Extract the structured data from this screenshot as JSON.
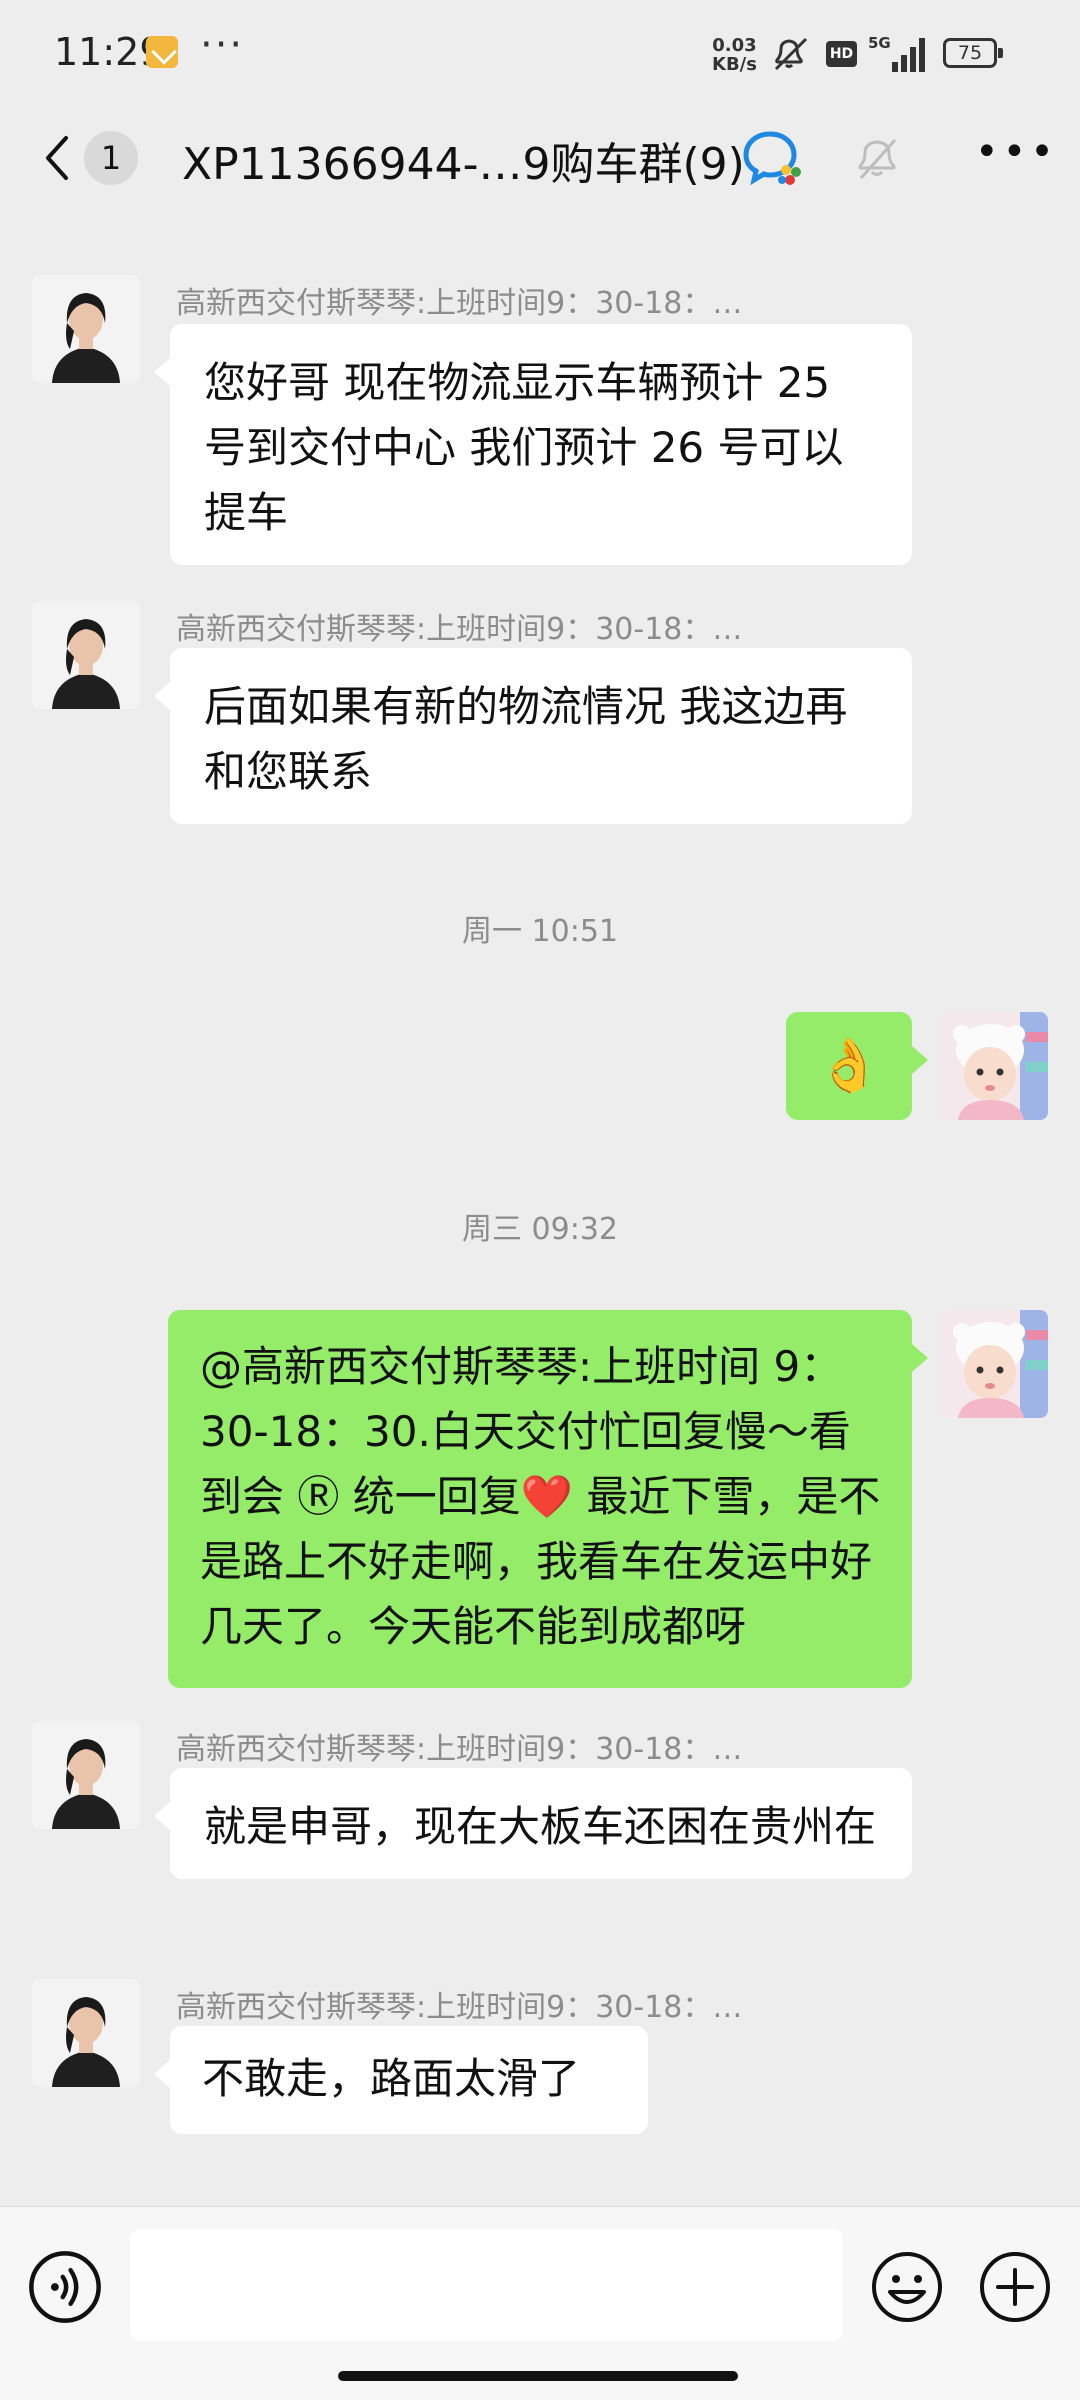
{
  "status_bar": {
    "time": "11:29",
    "more_dots": "···",
    "net_speed_value": "0.03",
    "net_speed_unit": "KB/s",
    "hd_label": "HD",
    "network_label": "5G",
    "battery_level": "75"
  },
  "header": {
    "unread_count": "1",
    "title": "XP11366944-…9购车群(9)"
  },
  "messages": [
    {
      "direction": "in",
      "sender": "高新西交付斯琴琴:上班时间9：30-18：…",
      "text": "您好哥 现在物流显示车辆预计 25 号到交付中心 我们预计 26 号可以提车"
    },
    {
      "direction": "in",
      "sender": "高新西交付斯琴琴:上班时间9：30-18：…",
      "text": "后面如果有新的物流情况 我这边再和您联系"
    },
    {
      "type": "timestamp",
      "text": "周一 10:51"
    },
    {
      "direction": "out",
      "text": "👌"
    },
    {
      "type": "timestamp",
      "text": "周三 09:32"
    },
    {
      "direction": "out",
      "text": "@高新西交付斯琴琴:上班时间 9：30-18：30.白天交付忙回复慢～看到会 Ⓡ 统一回复❤️ 最近下雪，是不是路上不好走啊，我看车在发运中好几天了。今天能不能到成都呀"
    },
    {
      "direction": "in",
      "sender": "高新西交付斯琴琴:上班时间9：30-18：…",
      "text": "就是申哥，现在大板车还困在贵州在"
    },
    {
      "direction": "in",
      "sender": "高新西交付斯琴琴:上班时间9：30-18：…",
      "text": "不敢走，路面太滑了"
    }
  ],
  "input_bar": {
    "placeholder": ""
  },
  "colors": {
    "background": "#ededed",
    "incoming_bubble": "#ffffff",
    "outgoing_bubble": "#95ec69",
    "meta_text": "#8c8c8c"
  }
}
